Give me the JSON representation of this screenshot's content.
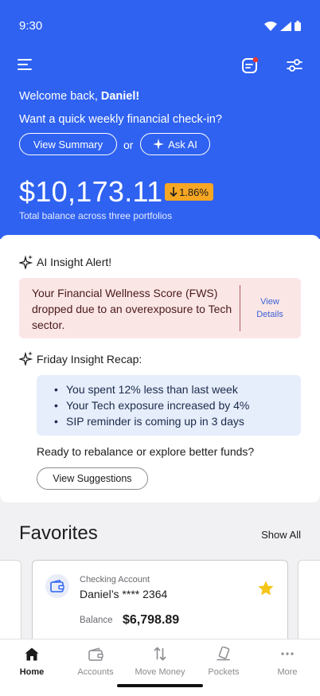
{
  "status_bar": {
    "time": "9:30"
  },
  "header": {
    "welcome_prefix": "Welcome back, ",
    "user_name": "Daniel!",
    "checkin_prompt": "Want a quick weekly financial check-in?",
    "view_summary_label": "View Summary",
    "or_label": "or",
    "ask_ai_label": "Ask AI",
    "total_balance": "$10,173.11",
    "change_pct": "1.86%",
    "balance_caption": "Total balance across three portfolios",
    "colors": {
      "brand": "#2f62f1",
      "change_badge": "#f5a623",
      "notification_dot": "#e53935"
    }
  },
  "insights": {
    "alert_title": "AI Insight Alert!",
    "alert_text": "Your Financial Wellness Score (FWS) dropped due to an overexposure to Tech sector.",
    "alert_link_line1": "View",
    "alert_link_line2": "Details",
    "recap_title": "Friday Insight Recap:",
    "recap_items": [
      "You spent 12% less than last week",
      "Your Tech exposure increased by 4%",
      "SIP reminder is coming up in 3 days"
    ],
    "rebalance_prompt": "Ready to rebalance or explore better funds?",
    "suggestions_label": "View Suggestions"
  },
  "favorites": {
    "title": "Favorites",
    "show_all_label": "Show All",
    "card": {
      "type": "Checking Account",
      "name": "Daniel’s **** 2364",
      "balance_label": "Balance",
      "balance_value": "$6,798.89",
      "starred": true,
      "star_color": "#f5c518"
    }
  },
  "bottom_nav": {
    "items": [
      {
        "label": "Home",
        "icon": "home-icon",
        "active": true
      },
      {
        "label": "Accounts",
        "icon": "wallet-icon",
        "active": false
      },
      {
        "label": "Move Money",
        "icon": "transfer-arrows-icon",
        "active": false
      },
      {
        "label": "Pockets",
        "icon": "pockets-icon",
        "active": false
      },
      {
        "label": "More",
        "icon": "more-dots-icon",
        "active": false
      }
    ]
  }
}
